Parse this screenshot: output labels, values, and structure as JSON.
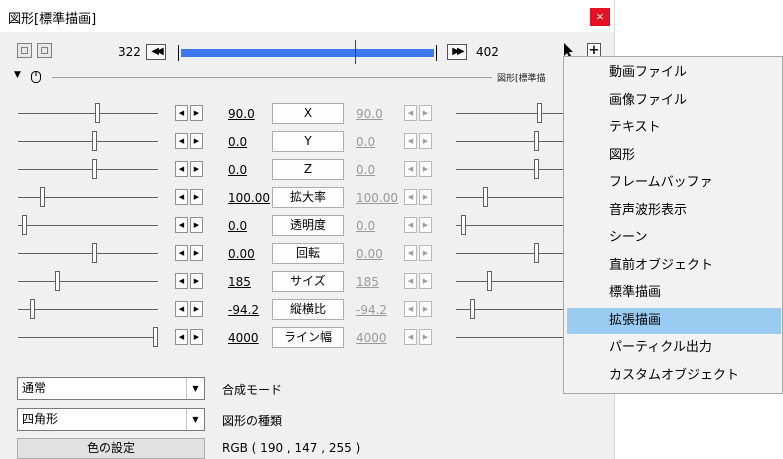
{
  "window": {
    "title": "図形[標準描画]",
    "close_label": "×"
  },
  "toolbar": {
    "start_frame": "322",
    "end_frame": "402",
    "prev_label": "◀◀",
    "next_label": "▶▶",
    "plus_label": "+",
    "timeline_progress": 0.68
  },
  "section_header": {
    "label": "図形[標準描"
  },
  "params": [
    {
      "name": "X",
      "value": "90.0",
      "end_value": "90.0"
    },
    {
      "name": "Y",
      "value": "0.0",
      "end_value": "0.0"
    },
    {
      "name": "Z",
      "value": "0.0",
      "end_value": "0.0"
    },
    {
      "name": "拡大率",
      "value": "100.00",
      "end_value": "100.00"
    },
    {
      "name": "透明度",
      "value": "0.0",
      "end_value": "0.0"
    },
    {
      "name": "回転",
      "value": "0.00",
      "end_value": "0.00"
    },
    {
      "name": "サイズ",
      "value": "185",
      "end_value": "185"
    },
    {
      "name": "縦横比",
      "value": "-94.2",
      "end_value": "-94.2"
    },
    {
      "name": "ライン幅",
      "value": "4000",
      "end_value": "4000"
    }
  ],
  "blend_mode": {
    "value": "通常",
    "label": "合成モード"
  },
  "shape_type": {
    "value": "四角形",
    "label": "図形の種類"
  },
  "color": {
    "button_label": "色の設定",
    "value_text": "RGB ( 190 , 147 , 255 )"
  },
  "context_menu": {
    "items": [
      "動画ファイル",
      "画像ファイル",
      "テキスト",
      "図形",
      "フレームバッファ",
      "音声波形表示",
      "シーン",
      "直前オブジェクト",
      "標準描画",
      "拡張描画",
      "パーティクル出力",
      "カスタムオブジェクト"
    ],
    "highlighted_index": 9
  },
  "colors": {
    "timeline_fill": "#3e78f0",
    "cursor": "#dd0000",
    "menu_highlight": "#99ccf0",
    "close_button": "#e81123"
  }
}
